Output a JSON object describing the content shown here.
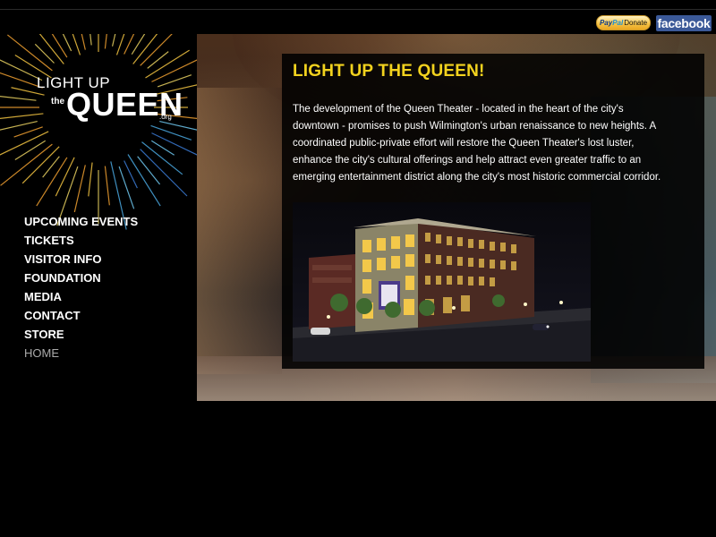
{
  "header": {
    "paypal": {
      "part1": "Pay",
      "part2": "Pal",
      "label": "Donate"
    },
    "facebook_label": "facebook"
  },
  "logo": {
    "line1": "LIGHT UP",
    "the": "the",
    "queen": "QUEEN",
    "org": ".org"
  },
  "nav": {
    "items": [
      {
        "label": "UPCOMING EVENTS"
      },
      {
        "label": "TICKETS"
      },
      {
        "label": "VISITOR INFO"
      },
      {
        "label": "FOUNDATION"
      },
      {
        "label": "MEDIA"
      },
      {
        "label": "CONTACT"
      },
      {
        "label": "STORE"
      },
      {
        "label": "HOME",
        "current": true
      }
    ]
  },
  "main": {
    "headline": "LIGHT UP THE QUEEN!",
    "intro": "The development of the Queen Theater - located in the heart of the city's downtown - promises to push Wilmington's urban renaissance to new heights. A coordinated public-private effort will restore the Queen Theater's lost luster, enhance the city's cultural offerings and help attract even greater traffic to an emerging entertainment district along the city's most historic commercial corridor."
  },
  "colors": {
    "headline": "#f2d21e",
    "facebook": "#3b5998",
    "nav_current": "#aaaaaa"
  }
}
